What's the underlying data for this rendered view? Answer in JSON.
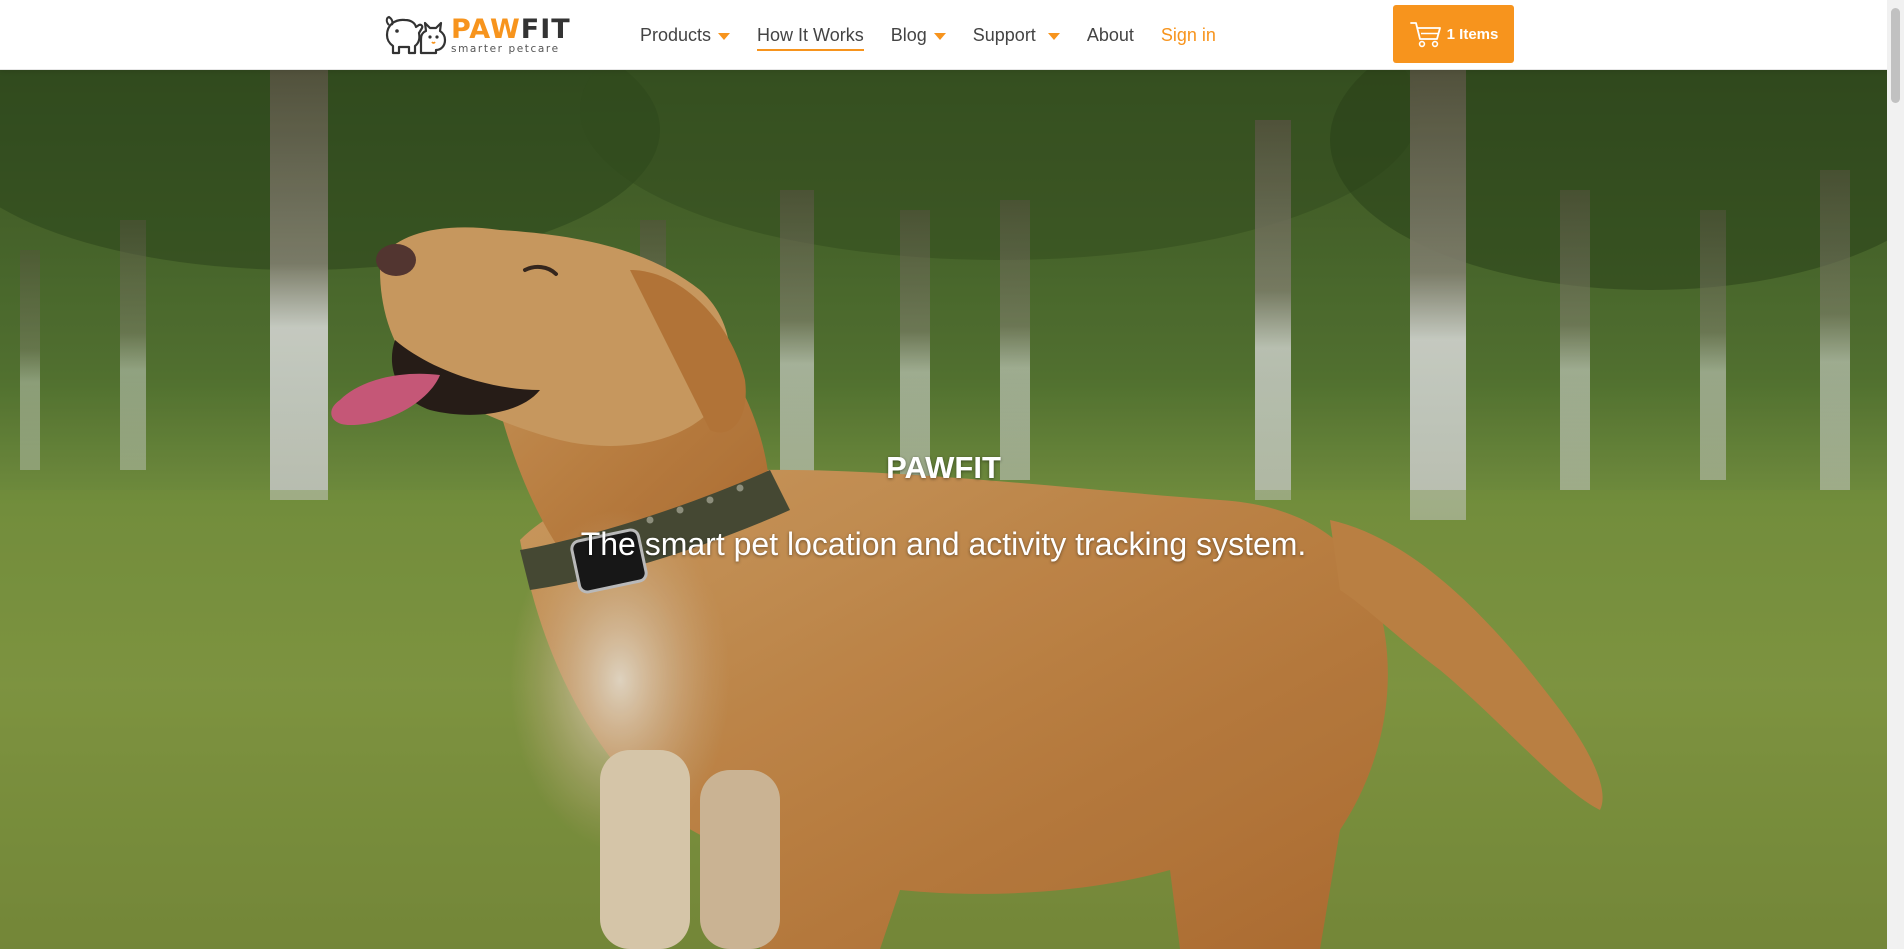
{
  "brand": {
    "name_part1": "PAW",
    "name_part2": "FIT",
    "tagline": "smarter petcare",
    "accent_color": "#f7941d"
  },
  "nav": {
    "items": [
      {
        "label": "Products",
        "has_dropdown": true
      },
      {
        "label": "How It Works",
        "active": true
      },
      {
        "label": "Blog",
        "has_dropdown": true
      },
      {
        "label": "Support",
        "has_dropdown": true
      },
      {
        "label": "About"
      },
      {
        "label": "Sign in"
      }
    ]
  },
  "cart": {
    "label": "1 Items",
    "icon": "shopping-cart-icon"
  },
  "hero": {
    "title": "PAWFIT",
    "subtitle": "The smart pet location and activity tracking system.",
    "image": "dog-with-gps-collar-photo"
  }
}
